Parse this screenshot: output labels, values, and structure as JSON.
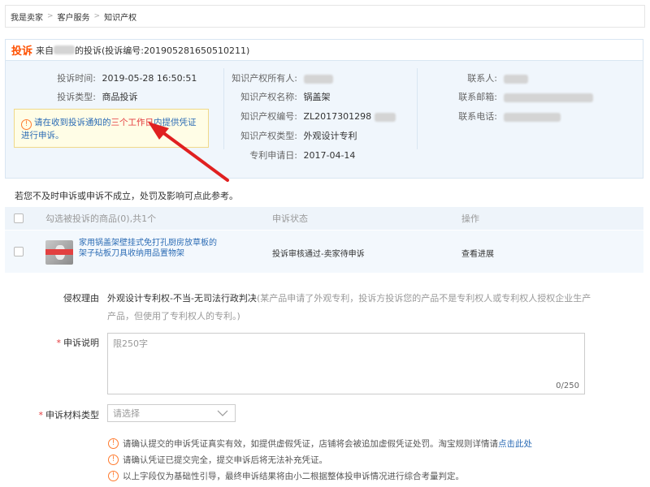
{
  "breadcrumb": {
    "items": [
      "我是卖家",
      "客户服务",
      "知识产权"
    ],
    "sep": ">"
  },
  "complaint": {
    "tag": "投诉",
    "from_prefix": "来自",
    "from_suffix": "的投诉",
    "number_text": "(投诉编号:201905281650510211)",
    "time_label": "投诉时间:",
    "time_value": "2019-05-28 16:50:51",
    "type_label": "投诉类型:",
    "type_value": "商品投诉",
    "owner_label": "知识产权所有人:",
    "ip_name_label": "知识产权名称:",
    "ip_name_value": "锅盖架",
    "ip_number_label": "知识产权编号:",
    "ip_number_value": "ZL2017301298",
    "ip_type_label": "知识产权类型:",
    "ip_type_value": "外观设计专利",
    "apply_date_label": "专利申请日:",
    "apply_date_value": "2017-04-14",
    "contact_label": "联系人:",
    "email_label": "联系邮箱:",
    "phone_label": "联系电话:"
  },
  "notice": {
    "icon": "!",
    "part1": "请在收到投诉通知的",
    "highlight": "三个工作日",
    "part2": "内提供凭证进行申诉。"
  },
  "hint_line": "若您不及时申诉或申诉不成立，处罚及影响可点此参考。",
  "table": {
    "head_select": "勾选被投诉的商品(0),共1个",
    "head_status": "申诉状态",
    "head_action": "操作",
    "row": {
      "title": "家用锅盖架壁挂式免打孔厨房放草板的架子砧板刀具收纳用品置物架",
      "status": "投诉审核通过-卖家待申诉",
      "action": "查看进展"
    }
  },
  "form": {
    "reason_label": "侵权理由",
    "reason_value": "外观设计专利权-不当-无司法行政判决",
    "reason_note": "(某产品申请了外观专利，投诉方投诉您的产品不是专利权人或专利权人授权企业生产产品，但使用了专利权人的专利。)",
    "desc_label": "申诉说明",
    "desc_placeholder": "限250字",
    "desc_counter": "0/250",
    "material_label": "申诉材料类型",
    "material_placeholder": "请选择",
    "required_mark": "*"
  },
  "tips": [
    {
      "text": "请确认提交的申诉凭证真实有效，如提供虚假凭证，店铺将会被追加虚假凭证处罚。淘宝规则详情请",
      "link": "点击此处"
    },
    {
      "text": "请确认凭证已提交完全，提交申诉后将无法补充凭证。",
      "link": ""
    },
    {
      "text": "以上字段仅为基础性引导，最终申诉结果将由小二根据整体投申诉情况进行综合考量判定。",
      "link": ""
    }
  ],
  "warn_icon_glyph": "!",
  "colors": {
    "accent_orange": "#ff5000",
    "link_blue": "#2c6cb5",
    "highlight_red": "#e4393c",
    "arrow_red": "#e02020",
    "info_bg": "#f0f6fc"
  }
}
